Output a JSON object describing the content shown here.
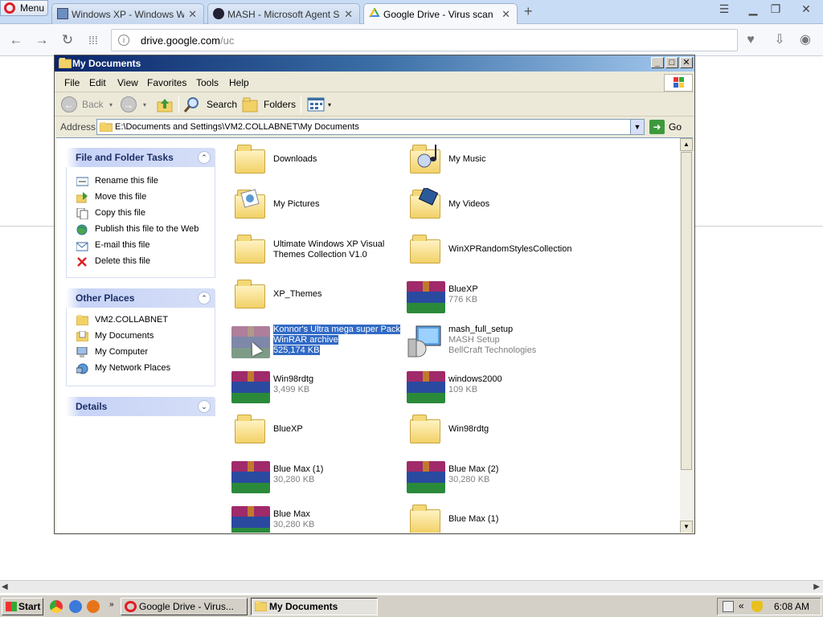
{
  "browser": {
    "menu_label": "Menu",
    "tabs": [
      {
        "title": "Windows XP - Windows Wallp",
        "active": false
      },
      {
        "title": "MASH - Microsoft Agent Scrip",
        "active": false
      },
      {
        "title": "Google Drive - Virus scan war",
        "active": true
      }
    ],
    "url_host": "drive.google.com",
    "url_path": "/uc"
  },
  "explorer": {
    "title": "My Documents",
    "menu": [
      "File",
      "Edit",
      "View",
      "Favorites",
      "Tools",
      "Help"
    ],
    "toolbar": {
      "back": "Back",
      "search": "Search",
      "folders": "Folders"
    },
    "address_label": "Address",
    "address_value": "E:\\Documents and Settings\\VM2.COLLABNET\\My Documents",
    "go_label": "Go",
    "file_tasks": {
      "title": "File and Folder Tasks",
      "items": [
        "Rename this file",
        "Move this file",
        "Copy this file",
        "Publish this file to the Web",
        "E-mail this file",
        "Delete this file"
      ]
    },
    "other_places": {
      "title": "Other Places",
      "items": [
        "VM2.COLLABNET",
        "My Documents",
        "My Computer",
        "My Network Places"
      ]
    },
    "details": {
      "title": "Details"
    },
    "files": [
      {
        "name": "Downloads",
        "kind": "folder"
      },
      {
        "name": "My Music",
        "kind": "folder"
      },
      {
        "name": "My Pictures",
        "kind": "folder"
      },
      {
        "name": "My Videos",
        "kind": "folder"
      },
      {
        "name": "Ultimate Windows XP Visual",
        "name2": "Themes Collection V1.0",
        "kind": "folder"
      },
      {
        "name": "WinXPRandomStylesCollection",
        "kind": "folder"
      },
      {
        "name": "XP_Themes",
        "kind": "folder"
      },
      {
        "name": "BlueXP",
        "sub": "776 KB",
        "kind": "rar"
      },
      {
        "name": "Konnor's Ultra mega super Pack",
        "sub": "WinRAR archive",
        "sub2": "525,174 KB",
        "kind": "rar",
        "selected": true
      },
      {
        "name": "mash_full_setup",
        "sub": "MASH Setup",
        "sub2": "BellCraft Technologies",
        "kind": "setup"
      },
      {
        "name": "Win98rdtg",
        "sub": "3,499 KB",
        "kind": "rar"
      },
      {
        "name": "windows2000",
        "sub": "109 KB",
        "kind": "rar"
      },
      {
        "name": "BlueXP",
        "kind": "folder"
      },
      {
        "name": "Win98rdtg",
        "kind": "folder"
      },
      {
        "name": "Blue Max (1)",
        "sub": "30,280 KB",
        "kind": "rar"
      },
      {
        "name": "Blue Max (2)",
        "sub": "30,280 KB",
        "kind": "rar"
      },
      {
        "name": "Blue Max",
        "sub": "30,280 KB",
        "kind": "rar"
      },
      {
        "name": "Blue Max (1)",
        "kind": "folder"
      }
    ]
  },
  "taskbar": {
    "start": "Start",
    "buttons": [
      "Google Drive - Virus...",
      "My Documents"
    ],
    "clock": "6:08 AM"
  },
  "colors": {
    "selection": "#316ac5",
    "xp_title": "#0a246a",
    "start_green": "#3a9a3a"
  }
}
